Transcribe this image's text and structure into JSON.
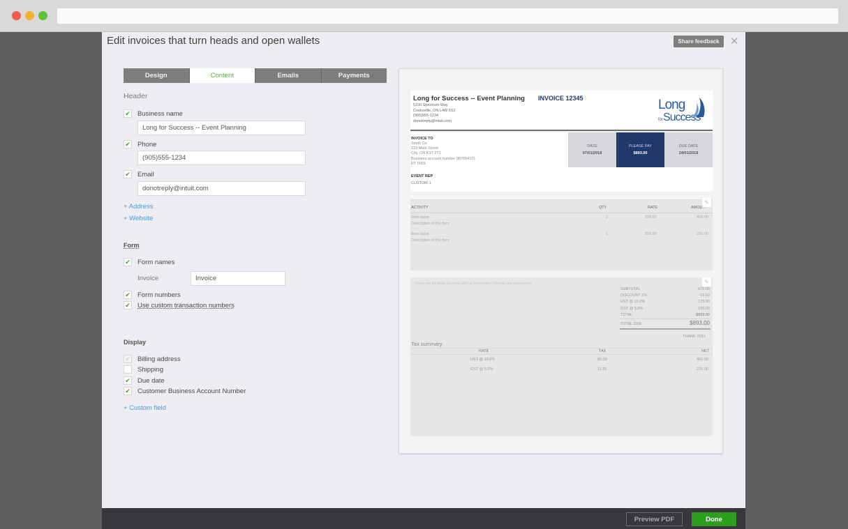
{
  "window": {
    "url": ""
  },
  "modal": {
    "title": "Edit invoices that turn heads and open wallets",
    "feedback_label": "Share feedback",
    "close_icon": "close-icon"
  },
  "tabs": [
    {
      "label": "Design",
      "active": false
    },
    {
      "label": "Content",
      "active": true
    },
    {
      "label": "Emails",
      "active": false
    },
    {
      "label": "Payments",
      "active": false
    }
  ],
  "header_section": {
    "title": "Header",
    "business_name": {
      "label": "Business name",
      "checked": true,
      "value": "Long for Success -- Event Planning"
    },
    "phone": {
      "label": "Phone",
      "checked": true,
      "value": "(905)555-1234"
    },
    "email": {
      "label": "Email",
      "checked": true,
      "value": "donotreply@intuit.com"
    },
    "add_address": "+ Address",
    "add_website": "+ Website"
  },
  "form_section": {
    "title": "Form",
    "form_names": {
      "label": "Form names",
      "checked": true
    },
    "invoice_label": "Invoice",
    "invoice_value": "Invoice",
    "form_numbers": {
      "label": "Form numbers",
      "checked": true
    },
    "custom_numbers": {
      "label": "Use custom transaction numbers",
      "checked": true
    }
  },
  "display_section": {
    "title": "Display",
    "billing_address": {
      "label": "Billing address",
      "checked": true,
      "disabled": true
    },
    "shipping": {
      "label": "Shipping",
      "checked": false
    },
    "due_date": {
      "label": "Due date",
      "checked": true
    },
    "account_number": {
      "label": "Customer Business Account Number",
      "checked": true
    },
    "add_custom_field": "+ Custom field"
  },
  "preview": {
    "business_name": "Long for Success -- Event Planning",
    "address_lines": [
      "5100 Spectrum Way",
      "Cooksville, ON L4W 5S2",
      "(905)555-1234",
      "donotreply@intuit.com"
    ],
    "invoice_number": "INVOICE 12345",
    "logo_top": "Long",
    "logo_for": "for",
    "logo_bottom": "Success",
    "invoice_to_label": "INVOICE TO",
    "invoice_to_lines": [
      "Smith Co.",
      "123 Main Street",
      "City, ON K1T 2T1",
      "Business account number 987654321",
      "RT 0001"
    ],
    "event_rep_label": "EVENT REP",
    "event_rep_value": "CUSTOM-1",
    "date_label": "DATE",
    "date_value": "07/01/2018",
    "please_pay_label": "PLEASE PAY",
    "please_pay_value": "$893.00",
    "due_date_label": "DUE DATE",
    "due_date_value": "24/01/2018",
    "items_header": {
      "activity": "ACTIVITY",
      "qty": "QTY",
      "rate": "RATE",
      "amount": "AMOU..."
    },
    "items": [
      {
        "name": "Item name",
        "description": "Description of the item",
        "qty": "2",
        "rate": "225.00",
        "amount": "450.00"
      },
      {
        "name": "Item name",
        "description": "Description of the item",
        "qty": "1",
        "rate": "225.00",
        "amount": "225.00"
      }
    ],
    "message": "Thank you for doing business with us. Remember, referrals are appreciated.",
    "totals": [
      {
        "label": "SUBTOTAL",
        "value": "675.00"
      },
      {
        "label": "DISCOUNT 2%",
        "value": "-13.50"
      },
      {
        "label": "HST @ 10.0%",
        "value": "173.00"
      },
      {
        "label": "GST @ 5.0%",
        "value": "105.00"
      },
      {
        "label": "TOTAL",
        "value": "$893.00"
      }
    ],
    "total_due_label": "TOTAL DUE",
    "total_due_value": "$893.00",
    "thank_you": "THANK YOU.",
    "tax_summary_title": "Tax summary",
    "tax_header": {
      "rate": "RATE",
      "tax": "TAX",
      "net": "NET"
    },
    "tax_rows": [
      {
        "rate": "HST @ 10.0%",
        "tax": "80.00",
        "net": "450.00"
      },
      {
        "rate": "GST @ 5.0%",
        "tax": "11.25",
        "net": "225.00"
      }
    ]
  },
  "footer": {
    "preview_pdf_label": "Preview PDF",
    "done_label": "Done"
  },
  "colors": {
    "accent_green": "#2ca01c",
    "tab_active_text": "#53b53a",
    "link_blue": "#4a9bd8",
    "invoice_navy": "#22376a"
  }
}
